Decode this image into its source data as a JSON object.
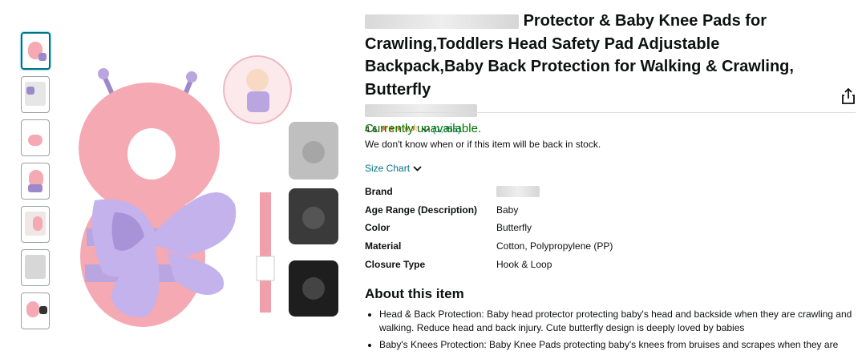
{
  "product": {
    "title_suffix": "Protector & Baby Knee Pads for Crawling,Toddlers Head Safety Pad Adjustable Backpack,Baby Back Protection for Walking & Crawling, Butterfly",
    "rating_value": "4.6",
    "rating_stars": "★★★★⯪",
    "rating_count": "(1,355)",
    "share_icon": "share-icon"
  },
  "thumbnails": [
    "thumbnail-1",
    "thumbnail-2",
    "thumbnail-3",
    "thumbnail-4",
    "thumbnail-5",
    "thumbnail-6",
    "thumbnail-7"
  ],
  "availability": {
    "status": "Currently unavailable.",
    "note": "We don't know when or if this item will be back in stock."
  },
  "size_chart": {
    "label": "Size Chart"
  },
  "specs": [
    {
      "key": "Brand",
      "value": ""
    },
    {
      "key": "Age Range (Description)",
      "value": "Baby"
    },
    {
      "key": "Color",
      "value": "Butterfly"
    },
    {
      "key": "Material",
      "value": "Cotton, Polypropylene (PP)"
    },
    {
      "key": "Closure Type",
      "value": "Hook & Loop"
    }
  ],
  "about": {
    "heading": "About this item",
    "bullets": [
      "Head & Back Protection: Baby head protector protecting baby's head and backside when they are crawling and walking. Reduce head and back injury. Cute butterfly design is deeply loved by babies",
      "Baby's Knees Protection: Baby Knee Pads protecting baby's knees from bruises and scrapes when they are"
    ]
  },
  "colors": {
    "link": "#007185",
    "available_green": "#007600",
    "star": "#de7921",
    "pink": "#f4a9b3",
    "lavender": "#b9a6e0"
  }
}
